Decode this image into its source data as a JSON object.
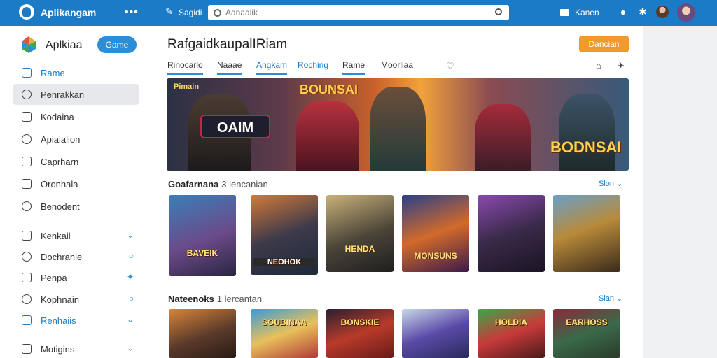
{
  "topbar": {
    "app_title": "Aplikangam",
    "dots": "•••",
    "quick_label": "Sagidi",
    "search_placeholder": "Aanaalik",
    "messages_label": "Kanen"
  },
  "sidebar": {
    "brand_title": "Aplkiaa",
    "brand_pill": "Game",
    "items": [
      {
        "label": "Rame"
      },
      {
        "label": "Penrakkan"
      },
      {
        "label": "Kodaina"
      },
      {
        "label": "Apiaialion"
      },
      {
        "label": "Caprharn"
      },
      {
        "label": "Oronhala"
      },
      {
        "label": "Benodent"
      },
      {
        "label": "Kenkail"
      },
      {
        "label": "Dochranie"
      },
      {
        "label": "Penpa"
      },
      {
        "label": "Kophnain"
      },
      {
        "label": "Renhaiis"
      },
      {
        "label": "Motigins"
      }
    ]
  },
  "main": {
    "page_title": "RafgaidkaupalIRiam",
    "donate_label": "Dancian",
    "tabs": [
      "Rinocarlo",
      "Naaae",
      "Angkam",
      "Roching",
      "Rame",
      "Moorliaa"
    ],
    "banner": {
      "ribbon": "Pimain",
      "title": "BOUNSAI",
      "logo": "OAIM",
      "end_title": "BODNSAI"
    },
    "section1": {
      "title": "Goafarnana",
      "subtitle": "3 lencanian",
      "link": "Slon ⌄"
    },
    "section2": {
      "title": "Nateenoks",
      "subtitle": "1 lercantan",
      "link": "Slan ⌄"
    },
    "row1_cards": [
      {
        "title": "BAVEIK"
      },
      {
        "title": "NEOHOK"
      },
      {
        "title": "HENDA"
      },
      {
        "title": "MONSUNS"
      },
      {
        "title": ""
      },
      {
        "title": ""
      }
    ],
    "row2_cards": [
      {
        "title": ""
      },
      {
        "title": "SOUBINAA"
      },
      {
        "title": "BONSKIE"
      },
      {
        "title": ""
      },
      {
        "title": "HOLDIA"
      },
      {
        "title": "EARHOSS"
      }
    ]
  },
  "colors": {
    "topbar": "#1b7bc7",
    "accent": "#2a8fd8",
    "donate": "#ef9a2b"
  }
}
